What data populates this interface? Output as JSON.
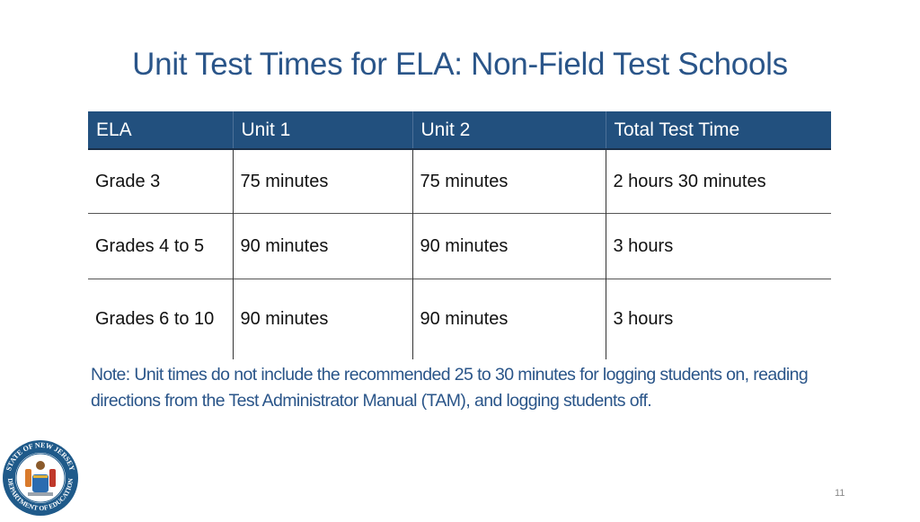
{
  "slide": {
    "title": "Unit Test Times for ELA: Non-Field Test Schools",
    "page_number": "11",
    "accent_color": "#22507e",
    "title_color": "#2a5589"
  },
  "table": {
    "headers": [
      "ELA",
      "Unit 1",
      "Unit 2",
      "Total Test Time"
    ],
    "rows": [
      [
        "Grade 3",
        "75 minutes",
        "75 minutes",
        "2 hours 30 minutes"
      ],
      [
        "Grades 4 to 5",
        "90 minutes",
        "90 minutes",
        "3 hours"
      ],
      [
        "Grades 6 to 10",
        "90 minutes",
        "90 minutes",
        "3 hours"
      ]
    ]
  },
  "note": "Note: Unit times do not include the recommended 25 to 30 minutes for logging students on, reading directions from the Test Administrator Manual (TAM), and logging students off.",
  "logo": {
    "icon": "nj-department-of-education-seal-icon",
    "outer_text_top": "STATE OF NEW JERSEY",
    "outer_text_bottom": "DEPARTMENT OF EDUCATION"
  }
}
